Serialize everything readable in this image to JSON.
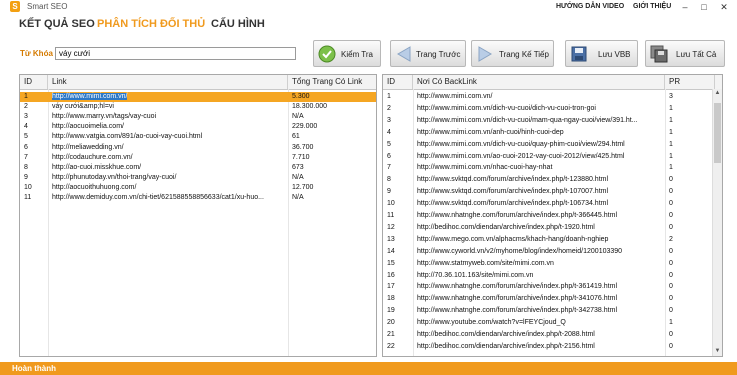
{
  "app": {
    "title": "Smart SEO",
    "icon": "app-logo-icon"
  },
  "top_links": {
    "video": "HƯỚNG DẪN VIDEO",
    "about": "GIỚI THIỆU"
  },
  "window_buttons": {
    "minimize": "–",
    "maximize": "□",
    "close": "✕"
  },
  "menu": {
    "items": [
      "KẾT QUẢ SEO",
      "PHÂN TÍCH ĐỐI THỦ",
      "CẤU HÌNH"
    ],
    "active_index": 1
  },
  "search": {
    "label": "Từ Khóa",
    "value": "váy cưới"
  },
  "toolbar": {
    "check": "Kiểm Tra",
    "prev": "Trang Trước",
    "next": "Trang Kế Tiếp",
    "save": "Lưu VBB",
    "save_all": "Lưu Tất Cả"
  },
  "left_table": {
    "headers": [
      "ID",
      "Link",
      "Tổng Trang Có Link"
    ],
    "rows": [
      [
        "1",
        "http://www.mimi.com.vn/",
        "5.300"
      ],
      [
        "2",
        "váy cưới&amp;hl=vi",
        "18.300.000"
      ],
      [
        "3",
        "http://www.marry.vn/tags/vay-cuoi",
        "N/A"
      ],
      [
        "4",
        "http://aocuoimelia.com/",
        "229.000"
      ],
      [
        "5",
        "http://www.vatgia.com/891/ao-cuoi-vay-cuoi.html",
        "61"
      ],
      [
        "6",
        "http://meliawedding.vn/",
        "36.700"
      ],
      [
        "7",
        "http://codauchure.com.vn/",
        "7.710"
      ],
      [
        "8",
        "http://ao-cuoi.misskhue.com/",
        "673"
      ],
      [
        "9",
        "http://phunutoday.vn/thoi-trang/vay-cuoi/",
        "N/A"
      ],
      [
        "10",
        "http://aocuoithuhuong.com/",
        "12.700"
      ],
      [
        "11",
        "http://www.demiduy.com.vn/chi-tiet/621588558856633/cat1/xu-huo...",
        "N/A"
      ]
    ],
    "selected_index": 0
  },
  "right_table": {
    "headers": [
      "ID",
      "Nơi Có BackLink",
      "PR"
    ],
    "rows": [
      [
        "1",
        "http://www.mimi.com.vn/",
        "3"
      ],
      [
        "2",
        "http://www.mimi.com.vn/dich-vu-cuoi/dich-vu-cuoi-tron-goi",
        "1"
      ],
      [
        "3",
        "http://www.mimi.com.vn/dich-vu-cuoi/mam-qua-ngay-cuoi/view/391.ht...",
        "1"
      ],
      [
        "4",
        "http://www.mimi.com.vn/anh-cuoi/hinh-cuoi-dep",
        "1"
      ],
      [
        "5",
        "http://www.mimi.com.vn/dich-vu-cuoi/quay-phim-cuoi/view/294.html",
        "1"
      ],
      [
        "6",
        "http://www.mimi.com.vn/ao-cuoi-2012-vay-cuoi-2012/view/425.html",
        "1"
      ],
      [
        "7",
        "http://www.mimi.com.vn/nhac-cuoi-hay-nhat",
        "1"
      ],
      [
        "8",
        "http://www.svktqd.com/forum/archive/index.php/t-123880.html",
        "0"
      ],
      [
        "9",
        "http://www.svktqd.com/forum/archive/index.php/t-107007.html",
        "0"
      ],
      [
        "10",
        "http://www.svktqd.com/forum/archive/index.php/t-106734.html",
        "0"
      ],
      [
        "11",
        "http://www.nhatnghe.com/forum/archive/index.php/t-366445.html",
        "0"
      ],
      [
        "12",
        "http://bedihoc.com/diendan/archive/index.php/t-1920.html",
        "0"
      ],
      [
        "13",
        "http://www.mego.com.vn/alphacms/khach-hang/doanh-nghiep",
        "2"
      ],
      [
        "14",
        "http://www.cyworld.vn/v2/myhome/blog/index/homeid/1200103390",
        "0"
      ],
      [
        "15",
        "http://www.statmyweb.com/site/mimi.com.vn",
        "0"
      ],
      [
        "16",
        "http://70.36.101.163/site/mimi.com.vn",
        "0"
      ],
      [
        "17",
        "http://www.nhatnghe.com/forum/archive/index.php/t-361419.html",
        "0"
      ],
      [
        "18",
        "http://www.nhatnghe.com/forum/archive/index.php/t-341076.html",
        "0"
      ],
      [
        "19",
        "http://www.nhatnghe.com/forum/archive/index.php/t-342738.html",
        "0"
      ],
      [
        "20",
        "http://www.youtube.com/watch?v=lFEYCjoud_Q",
        "1"
      ],
      [
        "21",
        "http://bedihoc.com/diendan/archive/index.php/t-2088.html",
        "0"
      ],
      [
        "22",
        "http://bedihoc.com/diendan/archive/index.php/t-2156.html",
        "0"
      ]
    ]
  },
  "status": {
    "text": "Hoàn thành"
  },
  "colors": {
    "accent": "#f09a1e",
    "selection": "#f5a623",
    "link_selected": "#2c78c7"
  }
}
